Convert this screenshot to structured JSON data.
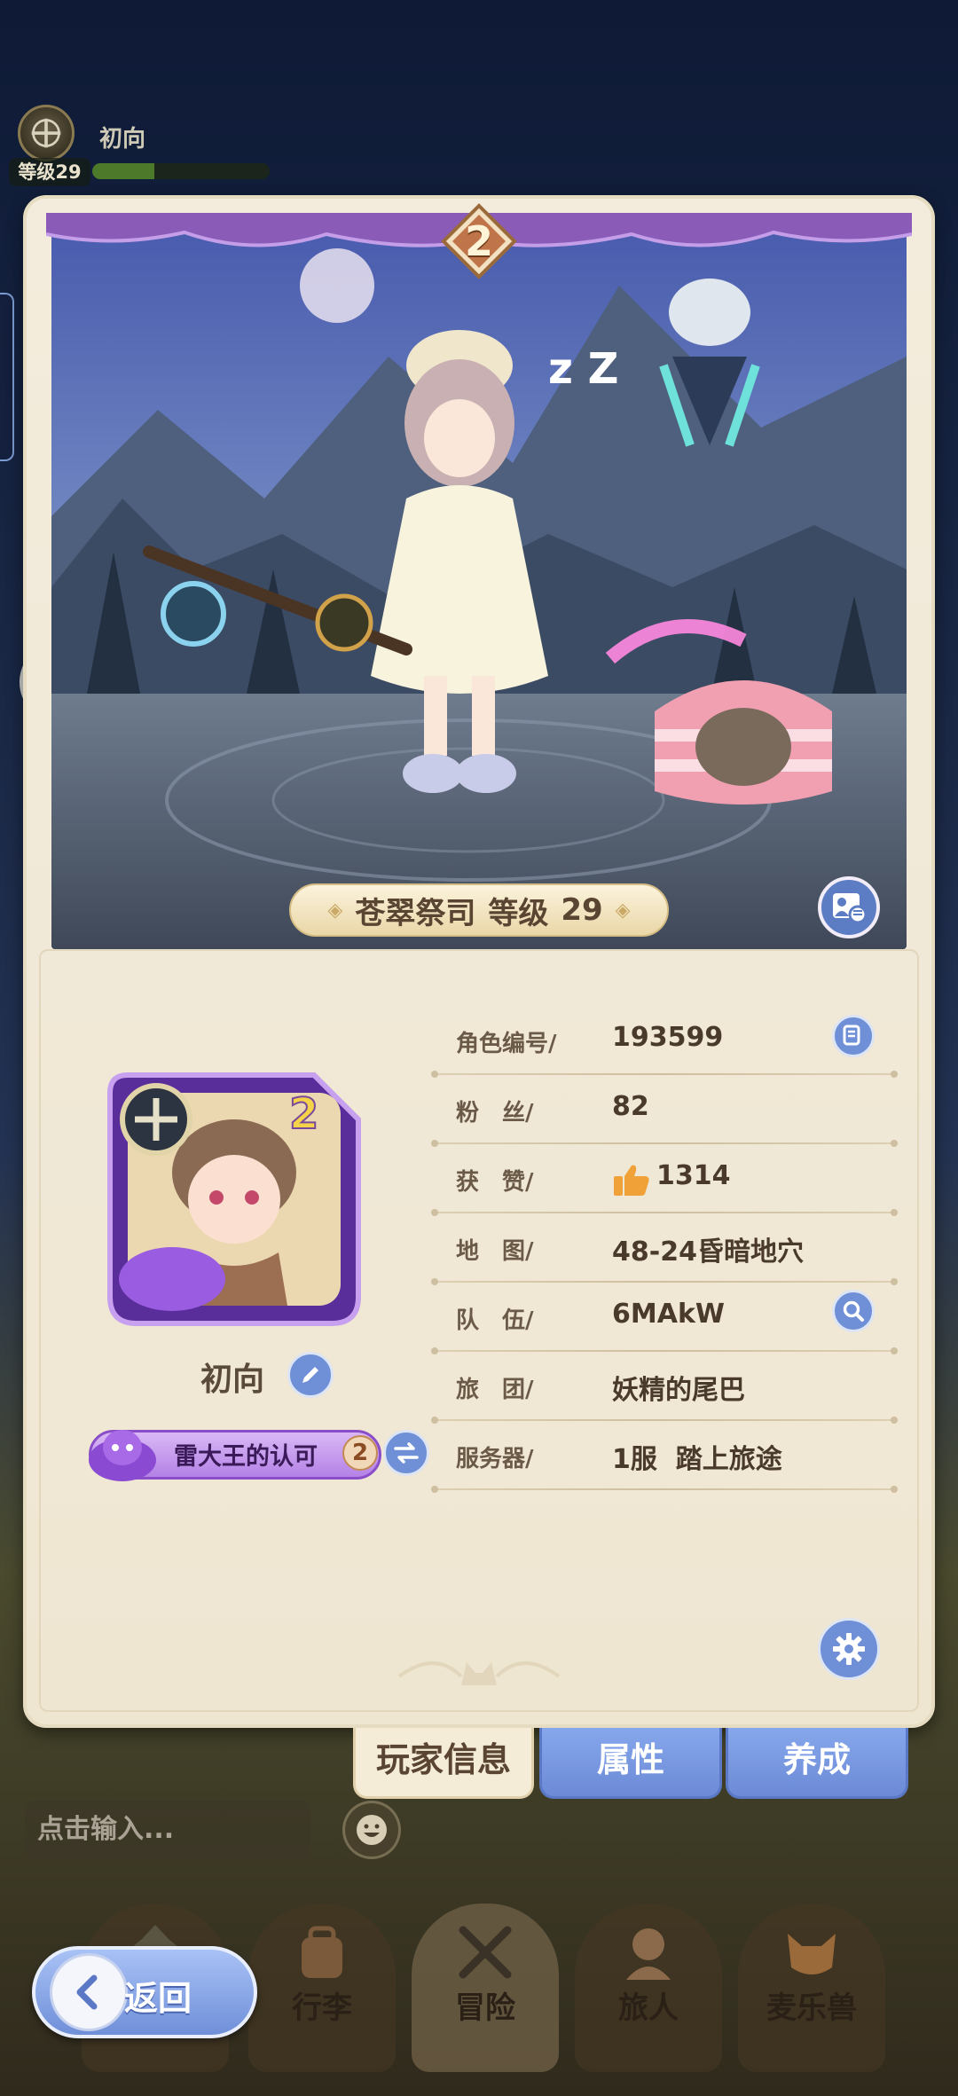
{
  "hud": {
    "name": "初向",
    "level_label": "等级29",
    "exp_fraction": 0.35
  },
  "panel": {
    "rank": "2",
    "class_banner": {
      "class_name": "苍翠祭司",
      "level_word": "等级",
      "level_value": "29"
    },
    "player": {
      "name": "初向",
      "title": "雷大王的认可",
      "title_rank": "2"
    },
    "info": [
      {
        "label": "角色编号/",
        "value": "193599"
      },
      {
        "label": "粉　丝/",
        "value": "82"
      },
      {
        "label": "获　赞/",
        "value": "1314"
      },
      {
        "label": "地　图/",
        "value": "48-24昏暗地穴"
      },
      {
        "label": "队　伍/",
        "value": "6MAkW"
      },
      {
        "label": "旅　团/",
        "value": "妖精的尾巴"
      },
      {
        "label": "服务器/",
        "value": "1服  踏上旅途"
      }
    ]
  },
  "tabs": {
    "player_info": "玩家信息",
    "attributes": "属性",
    "training": "养成"
  },
  "chat": {
    "placeholder": "点击输入..."
  },
  "nav": {
    "back": "返回",
    "items": [
      "行李",
      "冒险",
      "旅人",
      "麦乐兽"
    ]
  },
  "colors": {
    "accent_blue": "#6f8fd6",
    "panel_bg": "#f3ecdc",
    "title_purple": "#b482e6"
  }
}
